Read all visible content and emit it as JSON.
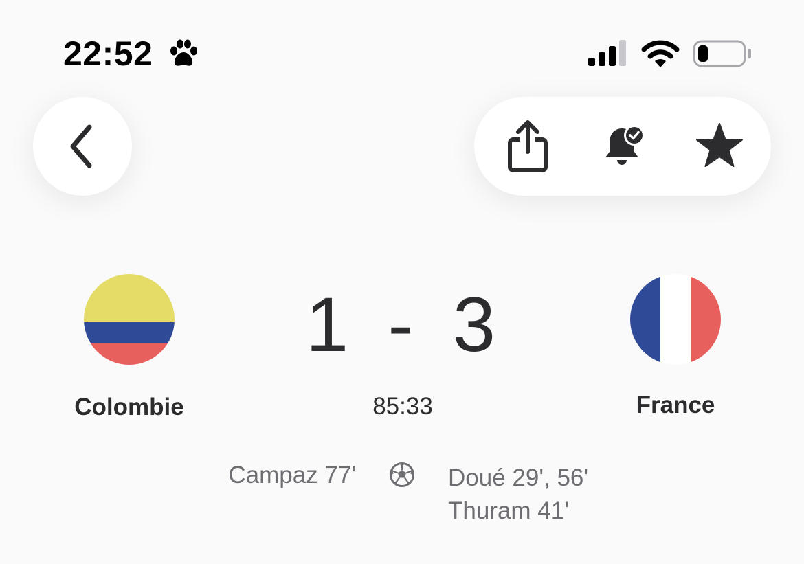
{
  "status_bar": {
    "time": "22:52",
    "icons": [
      "paw-icon",
      "cellular-signal-icon",
      "wifi-icon",
      "battery-icon"
    ]
  },
  "toolbar": {
    "back_icon": "chevron-left-icon",
    "actions": [
      "share-icon",
      "bell-check-icon",
      "star-icon"
    ]
  },
  "match": {
    "home_team": "Colombie",
    "away_team": "France",
    "home_score": "1",
    "away_score": "3",
    "score_separator": "-",
    "clock": "85:33",
    "home_scorers": [
      "Campaz 77'"
    ],
    "away_scorers": [
      "Doué 29', 56'",
      "Thuram 41'"
    ],
    "goal_icon": "soccer-ball-icon"
  },
  "colors": {
    "colombia_yellow": "#e5dc68",
    "colombia_blue": "#2f4a96",
    "colombia_red": "#e8605e",
    "france_blue": "#2f4a96",
    "france_white": "#ffffff",
    "france_red": "#e8605e"
  }
}
